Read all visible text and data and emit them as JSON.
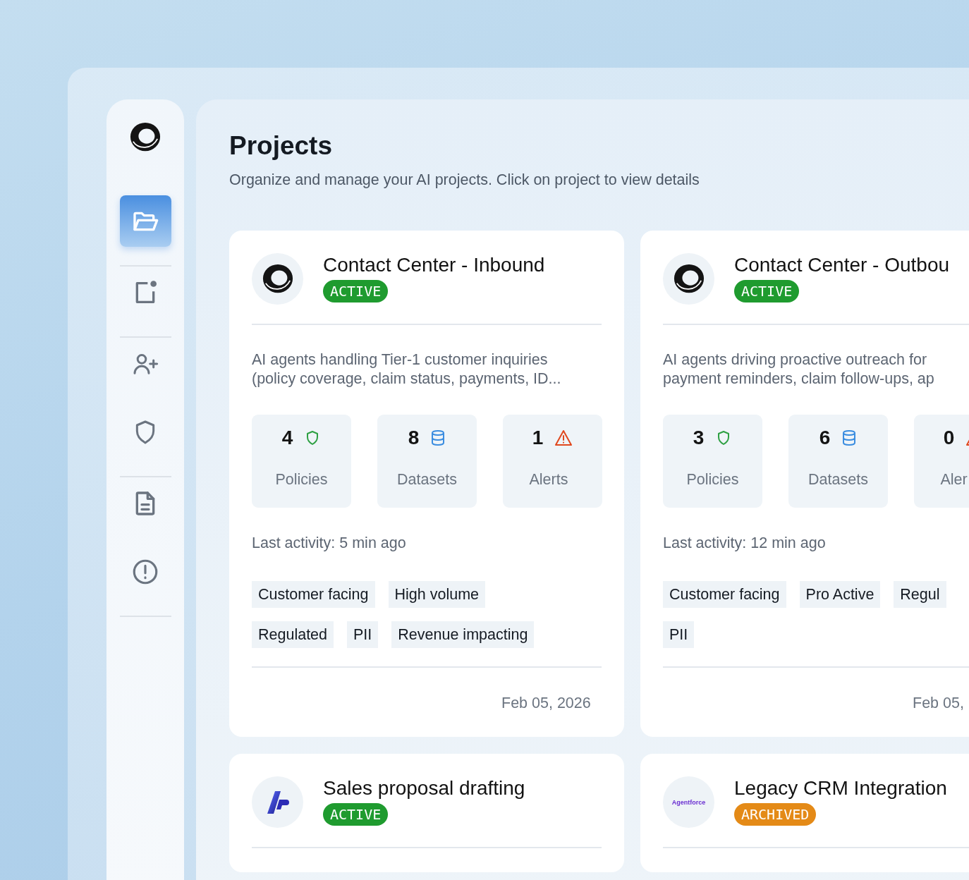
{
  "sidebar": {
    "groups": [
      [
        {
          "kind": "folder",
          "selected": true
        }
      ],
      [
        {
          "kind": "note",
          "selected": false
        }
      ],
      [
        {
          "kind": "user-plus",
          "selected": false
        },
        {
          "kind": "shield",
          "selected": false
        }
      ],
      [
        {
          "kind": "document",
          "selected": false
        },
        {
          "kind": "alert",
          "selected": false
        }
      ]
    ]
  },
  "page": {
    "title": "Projects",
    "subtitle": "Organize and manage your AI projects. Click on project to view details"
  },
  "projects": [
    {
      "logo": {
        "kind": "ring"
      },
      "title": "Contact Center - Inbound",
      "status": {
        "label": "ACTIVE",
        "kind": "active"
      },
      "description": [
        "AI agents handling Tier-1 customer inquiries",
        "(policy coverage, claim status, payments, ID..."
      ],
      "stats": [
        {
          "value": "4",
          "kind": "policies",
          "label": "Policies"
        },
        {
          "value": "8",
          "kind": "datasets",
          "label": "Datasets"
        },
        {
          "value": "1",
          "kind": "alerts",
          "label": "Alerts"
        }
      ],
      "last_activity": "Last activity: 5 min ago",
      "tag_rows": [
        [
          "Customer facing",
          "High volume"
        ],
        [
          "Regulated",
          "PII",
          "Revenue impacting"
        ]
      ],
      "date": "Feb 05, 2026"
    },
    {
      "logo": {
        "kind": "ring"
      },
      "title": "Contact Center - Outbou",
      "status": {
        "label": "ACTIVE",
        "kind": "active"
      },
      "description": [
        "AI agents driving proactive outreach for",
        "payment reminders, claim follow-ups, ap"
      ],
      "stats": [
        {
          "value": "3",
          "kind": "policies",
          "label": "Policies"
        },
        {
          "value": "6",
          "kind": "datasets",
          "label": "Datasets"
        },
        {
          "value": "0",
          "kind": "alerts",
          "label": "Aler"
        }
      ],
      "last_activity": "Last activity: 12 min ago",
      "tag_rows": [
        [
          "Customer facing",
          "Pro Active",
          "Regul"
        ],
        [
          "PII"
        ]
      ],
      "date": "Feb 05,"
    },
    {
      "logo": {
        "kind": "ribbon"
      },
      "title": "Sales proposal drafting",
      "status": {
        "label": "ACTIVE",
        "kind": "active"
      }
    },
    {
      "logo": {
        "kind": "wordmark",
        "text": "Agentforce"
      },
      "title": "Legacy CRM Integration",
      "status": {
        "label": "ARCHIVED",
        "kind": "archived"
      }
    }
  ]
}
